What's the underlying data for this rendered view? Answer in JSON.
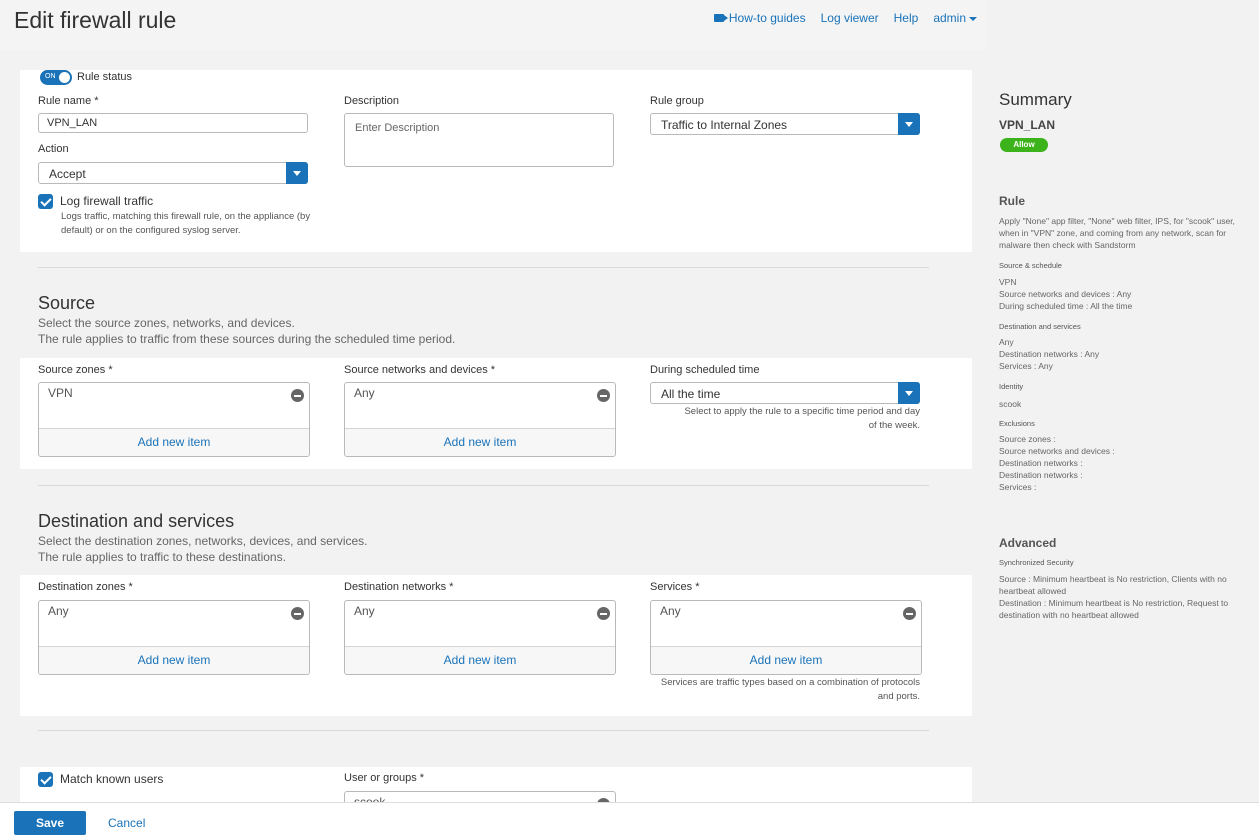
{
  "header": {
    "title": "Edit firewall rule",
    "nav": {
      "howto": "How-to guides",
      "logviewer": "Log viewer",
      "help": "Help",
      "user": "admin"
    }
  },
  "rule": {
    "status_on": "ON",
    "status_label": "Rule status",
    "name_label": "Rule name *",
    "name_value": "VPN_LAN",
    "description_label": "Description",
    "description_placeholder": "Enter Description",
    "group_label": "Rule group",
    "group_value": "Traffic to Internal Zones",
    "action_label": "Action",
    "action_value": "Accept",
    "log_label": "Log firewall traffic",
    "log_checked": true,
    "log_help": "Logs traffic, matching this firewall rule, on the appliance (by default) or on the configured syslog server."
  },
  "source": {
    "title": "Source",
    "desc1": "Select the source zones, networks, and devices.",
    "desc2": "The rule applies to traffic from these sources during the scheduled time period.",
    "zones_label": "Source zones *",
    "zones_value": "VPN",
    "networks_label": "Source networks and devices *",
    "networks_value": "Any",
    "schedule_label": "During scheduled time",
    "schedule_value": "All the time",
    "schedule_help": "Select to apply the rule to a specific time period and day of the week.",
    "add_item": "Add new item"
  },
  "destination": {
    "title": "Destination and services",
    "desc1": "Select the destination zones, networks, devices, and services.",
    "desc2": "The rule applies to traffic to these destinations.",
    "zones_label": "Destination zones *",
    "zones_value": "Any",
    "networks_label": "Destination networks *",
    "networks_value": "Any",
    "services_label": "Services *",
    "services_value": "Any",
    "services_help": "Services are traffic types based on a combination of protocols and ports.",
    "add_item": "Add new item"
  },
  "identity": {
    "match_label": "Match known users",
    "match_checked": true,
    "users_label": "User or groups *",
    "users_value": "scook"
  },
  "footer": {
    "save": "Save",
    "cancel": "Cancel"
  },
  "summary": {
    "title": "Summary",
    "name": "VPN_LAN",
    "badge": "Allow",
    "rule_heading": "Rule",
    "rule_text": "Apply \"None\" app filter, \"None\" web filter, IPS, for \"scook\" user, when in \"VPN\" zone, and coming from any network, scan for malware then check with Sandstorm",
    "src_heading": "Source & schedule",
    "src_lines": [
      "VPN",
      "Source networks and devices : Any",
      "During scheduled time : All the time"
    ],
    "dst_heading": "Destination and services",
    "dst_lines": [
      "Any",
      "Destination networks : Any",
      "Services : Any"
    ],
    "identity_heading": "Identity",
    "identity_value": "scook",
    "excl_heading": "Exclusions",
    "excl_lines": [
      "Source zones :",
      "Source networks and devices :",
      "Destination networks :",
      "Destination networks :",
      "Services :"
    ],
    "adv_heading": "Advanced",
    "adv_sub": "Synchronized Security",
    "adv_src": "Source : Minimum heartbeat is No restriction, Clients with no heartbeat allowed",
    "adv_dst": "Destination : Minimum heartbeat is No restriction, Request to destination with no heartbeat allowed"
  },
  "colors": {
    "accent": "#1a73b9",
    "allow": "#3cb21b"
  }
}
